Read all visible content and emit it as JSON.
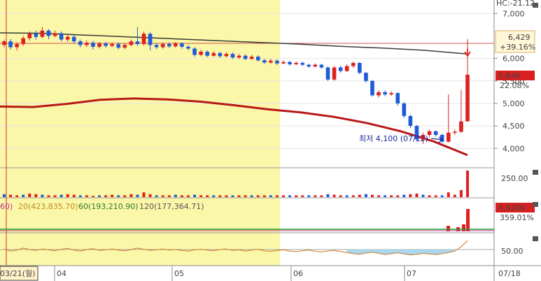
{
  "chart_data": {
    "type": "candlestick",
    "hc_label": "HC:-21.12",
    "price_axis": {
      "ticks": [
        "7,000",
        "6,000",
        "5,500",
        "5,000",
        "4,500",
        "4,000"
      ],
      "range": [
        3600,
        7300
      ]
    },
    "price_boxes": {
      "high": {
        "value": "6,429",
        "pct": "+39.16%"
      },
      "current": {
        "value": "5,640",
        "pct": "22.08%"
      }
    },
    "low_annotation": "최저 4,100 (07/12)",
    "ma_legend": [
      {
        "label": "60)",
        "color": "#c0308a"
      },
      {
        "label": "20(423,835.70)",
        "color": "#c08a20"
      },
      {
        "label": "60(193,210.90)",
        "color": "#2a7a2a"
      },
      {
        "label": "120(177,364.71)",
        "color": "#555555"
      }
    ],
    "volume_axis": {
      "ticks": [
        "250.00"
      ]
    },
    "volume2_box": {
      "value": "4,920K",
      "pct": "359.01%"
    },
    "osc_axis": {
      "ticks": [
        "50.00"
      ]
    },
    "x_labels": [
      "03/21(월)",
      "04",
      "05",
      "06",
      "07",
      "07/18"
    ],
    "candles": [
      {
        "o": 6300,
        "c": 6380,
        "h": 6420,
        "l": 6250
      },
      {
        "o": 6380,
        "c": 6250,
        "h": 6430,
        "l": 6200
      },
      {
        "o": 6250,
        "c": 6320,
        "h": 6360,
        "l": 6180
      },
      {
        "o": 6320,
        "c": 6450,
        "h": 6500,
        "l": 6280
      },
      {
        "o": 6450,
        "c": 6550,
        "h": 6600,
        "l": 6400
      },
      {
        "o": 6550,
        "c": 6480,
        "h": 6620,
        "l": 6420
      },
      {
        "o": 6480,
        "c": 6620,
        "h": 6700,
        "l": 6450
      },
      {
        "o": 6620,
        "c": 6500,
        "h": 6650,
        "l": 6430
      },
      {
        "o": 6500,
        "c": 6560,
        "h": 6620,
        "l": 6470
      },
      {
        "o": 6560,
        "c": 6420,
        "h": 6600,
        "l": 6380
      },
      {
        "o": 6420,
        "c": 6480,
        "h": 6530,
        "l": 6370
      },
      {
        "o": 6480,
        "c": 6380,
        "h": 6520,
        "l": 6330
      },
      {
        "o": 6380,
        "c": 6300,
        "h": 6420,
        "l": 6250
      },
      {
        "o": 6300,
        "c": 6350,
        "h": 6400,
        "l": 6260
      },
      {
        "o": 6350,
        "c": 6260,
        "h": 6390,
        "l": 6200
      },
      {
        "o": 6260,
        "c": 6330,
        "h": 6370,
        "l": 6220
      },
      {
        "o": 6330,
        "c": 6280,
        "h": 6370,
        "l": 6240
      },
      {
        "o": 6280,
        "c": 6320,
        "h": 6360,
        "l": 6250
      },
      {
        "o": 6320,
        "c": 6240,
        "h": 6360,
        "l": 6200
      },
      {
        "o": 6240,
        "c": 6300,
        "h": 6340,
        "l": 6210
      },
      {
        "o": 6300,
        "c": 6380,
        "h": 6420,
        "l": 6270
      },
      {
        "o": 6380,
        "c": 6320,
        "h": 6700,
        "l": 6280
      },
      {
        "o": 6320,
        "c": 6550,
        "h": 6600,
        "l": 6290
      },
      {
        "o": 6550,
        "c": 6300,
        "h": 6580,
        "l": 6180
      },
      {
        "o": 6300,
        "c": 6250,
        "h": 6340,
        "l": 6210
      },
      {
        "o": 6250,
        "c": 6320,
        "h": 6360,
        "l": 6220
      },
      {
        "o": 6320,
        "c": 6270,
        "h": 6360,
        "l": 6230
      },
      {
        "o": 6270,
        "c": 6330,
        "h": 6370,
        "l": 6240
      },
      {
        "o": 6330,
        "c": 6260,
        "h": 6360,
        "l": 6220
      },
      {
        "o": 6260,
        "c": 6220,
        "h": 6300,
        "l": 6180
      },
      {
        "o": 6220,
        "c": 6080,
        "h": 6250,
        "l": 6040
      },
      {
        "o": 6080,
        "c": 6150,
        "h": 6190,
        "l": 6050
      },
      {
        "o": 6150,
        "c": 6060,
        "h": 6180,
        "l": 6030
      },
      {
        "o": 6060,
        "c": 6120,
        "h": 6160,
        "l": 6040
      },
      {
        "o": 6120,
        "c": 6050,
        "h": 6150,
        "l": 6010
      },
      {
        "o": 6050,
        "c": 6100,
        "h": 6140,
        "l": 6020
      },
      {
        "o": 6100,
        "c": 6020,
        "h": 6130,
        "l": 5990
      },
      {
        "o": 6020,
        "c": 6060,
        "h": 6100,
        "l": 5990
      },
      {
        "o": 6060,
        "c": 5990,
        "h": 6090,
        "l": 5960
      },
      {
        "o": 5990,
        "c": 6040,
        "h": 6080,
        "l": 5970
      },
      {
        "o": 6040,
        "c": 5960,
        "h": 6070,
        "l": 5930
      },
      {
        "o": 5960,
        "c": 5910,
        "h": 5990,
        "l": 5880
      },
      {
        "o": 5910,
        "c": 5950,
        "h": 5990,
        "l": 5880
      },
      {
        "o": 5950,
        "c": 5890,
        "h": 5980,
        "l": 5850
      },
      {
        "o": 5890,
        "c": 5920,
        "h": 5960,
        "l": 5870
      },
      {
        "o": 5920,
        "c": 5870,
        "h": 5950,
        "l": 5840
      },
      {
        "o": 5870,
        "c": 5900,
        "h": 5940,
        "l": 5850
      },
      {
        "o": 5900,
        "c": 5860,
        "h": 5930,
        "l": 5830
      },
      {
        "o": 5860,
        "c": 5820,
        "h": 5880,
        "l": 5790
      },
      {
        "o": 5820,
        "c": 5860,
        "h": 5890,
        "l": 5800
      },
      {
        "o": 5860,
        "c": 5800,
        "h": 5880,
        "l": 5770
      },
      {
        "o": 5800,
        "c": 5530,
        "h": 5820,
        "l": 5500
      },
      {
        "o": 5530,
        "c": 5800,
        "h": 5830,
        "l": 5500
      },
      {
        "o": 5800,
        "c": 5720,
        "h": 5840,
        "l": 5680
      },
      {
        "o": 5720,
        "c": 5830,
        "h": 5870,
        "l": 5700
      },
      {
        "o": 5830,
        "c": 5900,
        "h": 5930,
        "l": 5790
      },
      {
        "o": 5900,
        "c": 5680,
        "h": 5920,
        "l": 5650
      },
      {
        "o": 5680,
        "c": 5500,
        "h": 5700,
        "l": 5460
      },
      {
        "o": 5500,
        "c": 5180,
        "h": 5520,
        "l": 5150
      },
      {
        "o": 5180,
        "c": 5250,
        "h": 5290,
        "l": 5130
      },
      {
        "o": 5250,
        "c": 5200,
        "h": 5290,
        "l": 5160
      },
      {
        "o": 5200,
        "c": 5230,
        "h": 5270,
        "l": 5170
      },
      {
        "o": 5230,
        "c": 5000,
        "h": 5250,
        "l": 4950
      },
      {
        "o": 5000,
        "c": 4720,
        "h": 5030,
        "l": 4680
      },
      {
        "o": 4720,
        "c": 4500,
        "h": 4750,
        "l": 4450
      },
      {
        "o": 4500,
        "c": 4200,
        "h": 4520,
        "l": 4150
      },
      {
        "o": 4200,
        "c": 4300,
        "h": 4350,
        "l": 4100
      },
      {
        "o": 4300,
        "c": 4380,
        "h": 4420,
        "l": 4250
      },
      {
        "o": 4380,
        "c": 4300,
        "h": 4400,
        "l": 4260
      },
      {
        "o": 4300,
        "c": 4150,
        "h": 4320,
        "l": 4120
      },
      {
        "o": 4150,
        "c": 4350,
        "h": 5200,
        "l": 4130
      },
      {
        "o": 4350,
        "c": 4370,
        "h": 4420,
        "l": 4300
      },
      {
        "o": 4370,
        "c": 4600,
        "h": 5300,
        "l": 4340
      },
      {
        "o": 4600,
        "c": 5640,
        "h": 6429,
        "l": 4600
      }
    ],
    "ma_black": [
      6570,
      6560,
      6520,
      6480,
      6440,
      6400,
      6360,
      6320,
      6270,
      6230,
      6180,
      6100
    ],
    "ma_red": [
      4930,
      4920,
      4990,
      5080,
      5110,
      5090,
      5040,
      4960,
      4870,
      4800,
      4700,
      4560,
      4380,
      4150,
      3850
    ],
    "volume": [
      5,
      4,
      3,
      4,
      6,
      5,
      4,
      3,
      3,
      4,
      5,
      4,
      3,
      3,
      2,
      3,
      3,
      4,
      3,
      3,
      5,
      4,
      8,
      5,
      3,
      3,
      3,
      4,
      3,
      3,
      4,
      3,
      3,
      3,
      3,
      3,
      3,
      3,
      3,
      3,
      3,
      3,
      3,
      3,
      3,
      3,
      3,
      3,
      3,
      3,
      3,
      5,
      4,
      3,
      3,
      3,
      4,
      5,
      4,
      3,
      3,
      3,
      3,
      4,
      5,
      6,
      4,
      3,
      3,
      3,
      8,
      4,
      12,
      45
    ],
    "oscillator": [
      52,
      45,
      48,
      55,
      50,
      47,
      52,
      49,
      46,
      51,
      54,
      48,
      45,
      50,
      53,
      47,
      49,
      52,
      48,
      46,
      50,
      55,
      51,
      47,
      49,
      52,
      48,
      50,
      47,
      45,
      49,
      51,
      48,
      46,
      50,
      52,
      47,
      49,
      45,
      48,
      51,
      46,
      44,
      47,
      49,
      45,
      43,
      46,
      48,
      44,
      42,
      45,
      47,
      43,
      40,
      36,
      34,
      38,
      41,
      37,
      33,
      36,
      39,
      35,
      32,
      34,
      37,
      35,
      33,
      36,
      40,
      45,
      60,
      80
    ]
  }
}
